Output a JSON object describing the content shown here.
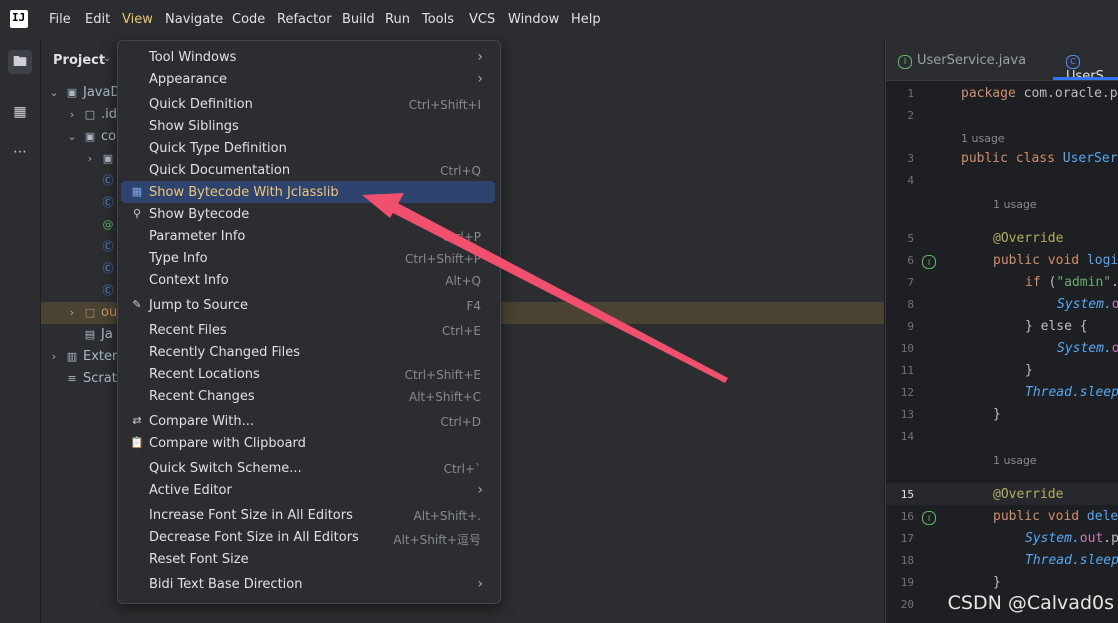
{
  "menubar": {
    "items": [
      "File",
      "Edit",
      "View",
      "Navigate",
      "Code",
      "Refactor",
      "Build",
      "Run",
      "Tools",
      "VCS",
      "Window",
      "Help"
    ],
    "active": "View"
  },
  "project": {
    "title": "Project",
    "tree": [
      {
        "label": "JavaD",
        "icon": "module-folder-icon"
      },
      {
        "label": ".id",
        "icon": "folder-icon"
      },
      {
        "label": "co",
        "icon": "package-folder-icon"
      },
      {
        "label": "",
        "icon": "package-icon"
      },
      {
        "label": "",
        "icon": "class-icon"
      },
      {
        "label": "",
        "icon": "class-icon"
      },
      {
        "label": "",
        "icon": "annotation-icon"
      },
      {
        "label": "",
        "icon": "class-icon"
      },
      {
        "label": "",
        "icon": "class-icon"
      },
      {
        "label": "",
        "icon": "class-icon"
      },
      {
        "label": "ou",
        "icon": "out-folder-icon"
      },
      {
        "label": "Ja",
        "icon": "file-icon"
      },
      {
        "label": "Exter",
        "icon": "library-icon"
      },
      {
        "label": "Scrat",
        "icon": "scratch-icon"
      }
    ]
  },
  "editor": {
    "tabs": [
      {
        "label": "UserService.java",
        "active": false
      },
      {
        "label": "UserS",
        "active": true
      }
    ],
    "lines": [
      "1",
      "2",
      "3",
      "4",
      "5",
      "6",
      "7",
      "8",
      "9",
      "10",
      "11",
      "12",
      "13",
      "14",
      "15",
      "16",
      "17",
      "18",
      "19",
      "20"
    ],
    "current_line": "15",
    "usage_hint": "1 usage",
    "code": {
      "l1_kw": "package",
      "l1_rest": " com.oracle.p",
      "l3_kw": "public class",
      "l3_rest": " UserSer",
      "l5": "@Override",
      "l6_kw": "public void",
      "l6_rest": " logi",
      "l7_kw": "if",
      "l7_str": "\"admin\"",
      "l7_rest": ".",
      "l8": "System.",
      "l8b": "o",
      "l9": "} else {",
      "l10": "System.",
      "l10b": "o",
      "l11": "}",
      "l12": "Thread.",
      "l12b": "sleep",
      "l13": "}",
      "l15": "@Override",
      "l16_kw": "public void",
      "l16_rest": " dele",
      "l17": "System.",
      "l17b": "out",
      "l17c": ".p",
      "l18": "Thread.",
      "l18b": "sleep",
      "l19": "}"
    }
  },
  "view_menu": {
    "items": [
      {
        "label": "Tool Windows",
        "shortcut": "",
        "submenu": true
      },
      {
        "label": "Appearance",
        "shortcut": "",
        "submenu": true
      },
      {
        "label": "Quick Definition",
        "shortcut": "Ctrl+Shift+I"
      },
      {
        "label": "Show Siblings",
        "shortcut": ""
      },
      {
        "label": "Quick Type Definition",
        "shortcut": ""
      },
      {
        "label": "Quick Documentation",
        "shortcut": "Ctrl+Q"
      },
      {
        "label": "Show Bytecode With Jclasslib",
        "shortcut": "",
        "highlighted": true,
        "icon": "bytecode-icon"
      },
      {
        "label": "Show Bytecode",
        "shortcut": "",
        "icon": "bytecode-search-icon"
      },
      {
        "label": "Parameter Info",
        "shortcut": "Ctrl+P"
      },
      {
        "label": "Type Info",
        "shortcut": "Ctrl+Shift+P"
      },
      {
        "label": "Context Info",
        "shortcut": "Alt+Q"
      },
      {
        "label": "Jump to Source",
        "shortcut": "F4",
        "icon": "pencil-icon"
      },
      {
        "label": "Recent Files",
        "shortcut": "Ctrl+E"
      },
      {
        "label": "Recently Changed Files",
        "shortcut": ""
      },
      {
        "label": "Recent Locations",
        "shortcut": "Ctrl+Shift+E"
      },
      {
        "label": "Recent Changes",
        "shortcut": "Alt+Shift+C"
      },
      {
        "label": "Compare With...",
        "shortcut": "Ctrl+D",
        "icon": "compare-icon"
      },
      {
        "label": "Compare with Clipboard",
        "shortcut": "",
        "icon": "clipboard-icon"
      },
      {
        "label": "Quick Switch Scheme...",
        "shortcut": "Ctrl+`"
      },
      {
        "label": "Active Editor",
        "shortcut": "",
        "submenu": true
      },
      {
        "label": "Increase Font Size in All Editors",
        "shortcut": "Alt+Shift+."
      },
      {
        "label": "Decrease Font Size in All Editors",
        "shortcut": "Alt+Shift+逗号"
      },
      {
        "label": "Reset Font Size",
        "shortcut": ""
      },
      {
        "label": "Bidi Text Base Direction",
        "shortcut": "",
        "submenu": true
      }
    ]
  },
  "watermark": "CSDN @Calvad0s",
  "colors": {
    "accent": "#3574f0",
    "highlight": "#2e436e",
    "arrow": "#f0506e"
  }
}
